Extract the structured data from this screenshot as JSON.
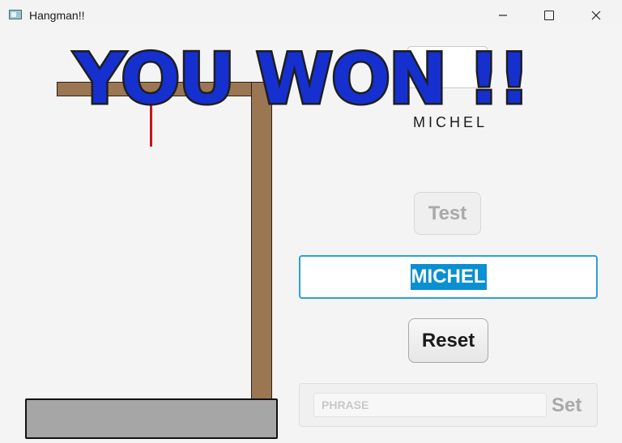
{
  "window": {
    "title": "Hangman!!",
    "controls": {
      "minimize": "—",
      "maximize": "",
      "close": "✕"
    }
  },
  "game": {
    "banner": "YOU WON !!",
    "banner_color": "#1530cf",
    "masked_word": "MICHEL",
    "letter_box_value": ""
  },
  "controls": {
    "test_label": "Test",
    "answer_value": "MICHEL",
    "reset_label": "Reset",
    "phrase_placeholder": "PHRASE",
    "set_label": "Set"
  },
  "colors": {
    "gallows_wood": "#9b7653",
    "rope": "#cc1515",
    "base": "#a6a6a6",
    "focus_border": "#2aa0d8",
    "selection": "#0a8fd0"
  }
}
